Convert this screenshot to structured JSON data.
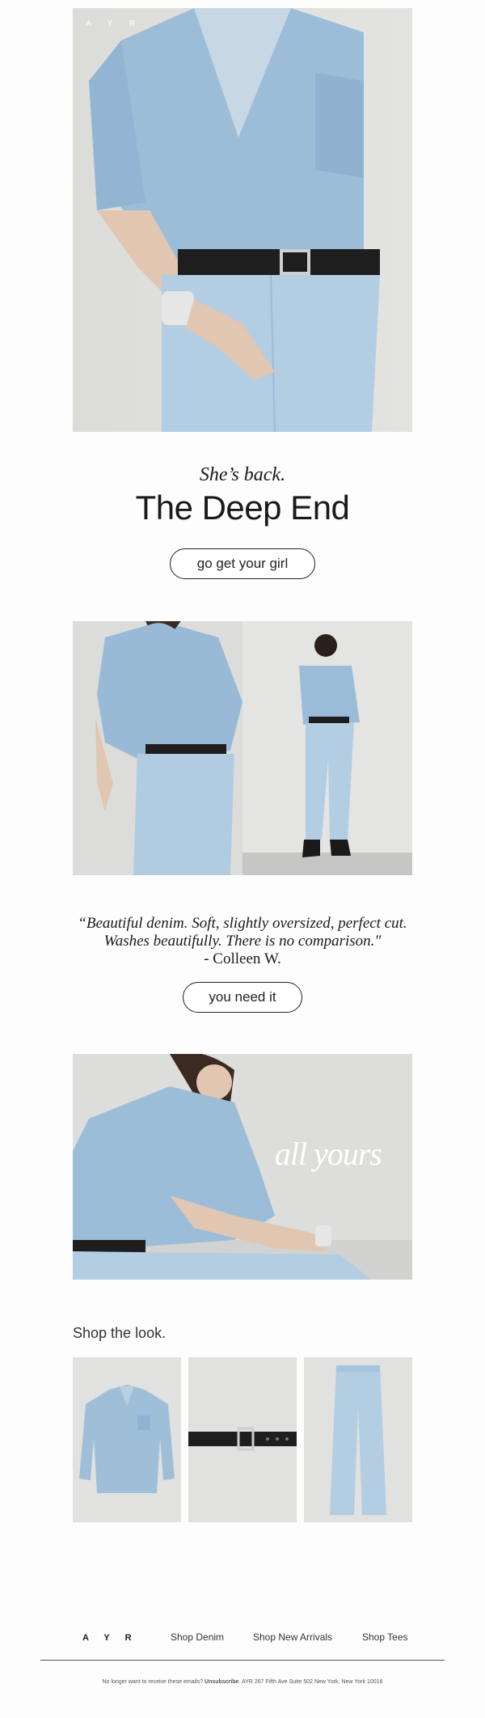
{
  "brand": {
    "logo": "A Y R"
  },
  "hero": {
    "image": "hero-denim-shirt-photo",
    "kicker": "She’s back.",
    "title": "The Deep End",
    "cta": "go get your girl"
  },
  "review": {
    "quote_line1": "“Beautiful denim. Soft, slightly oversized, perfect cut.",
    "quote_line2": "Washes beautifully. There is no comparison.\"",
    "author": "- Colleen W.",
    "cta": "you need it"
  },
  "feature": {
    "overlay": "all yours"
  },
  "shop_the_look": {
    "title": "Shop the look.",
    "products": [
      "denim-shirt",
      "black-belt",
      "light-wash-jeans"
    ]
  },
  "footer": {
    "logo": "A Y R",
    "links": [
      "Shop Denim",
      "Shop New Arrivals",
      "Shop Tees"
    ],
    "legal_prefix": "No longer want to receive these emails? ",
    "unsubscribe": "Unsubscribe",
    "legal_suffix": ". AYR 267 Fifth Ave Suite 502 New York, New York 10016"
  },
  "colors": {
    "denim": "#9fbfd9",
    "background": "#fdfdfd",
    "text": "#1a1a1a"
  }
}
